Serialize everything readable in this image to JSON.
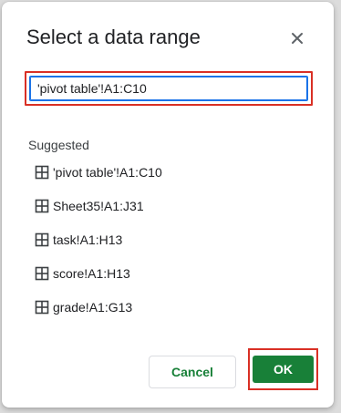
{
  "dialog": {
    "title": "Select a data range",
    "close_icon": "close-icon",
    "range_input": {
      "value": "'pivot table'!A1:C10"
    },
    "suggested_label": "Suggested",
    "suggestions": [
      {
        "icon": "grid-icon",
        "label": "'pivot table'!A1:C10"
      },
      {
        "icon": "grid-icon",
        "label": "Sheet35!A1:J31"
      },
      {
        "icon": "grid-icon",
        "label": "task!A1:H13"
      },
      {
        "icon": "grid-icon",
        "label": "score!A1:H13"
      },
      {
        "icon": "grid-icon",
        "label": "grade!A1:G13"
      }
    ],
    "cancel_label": "Cancel",
    "ok_label": "OK"
  },
  "colors": {
    "accent_green": "#188038",
    "focus_blue": "#1a73e8",
    "highlight_red": "#d93025"
  }
}
